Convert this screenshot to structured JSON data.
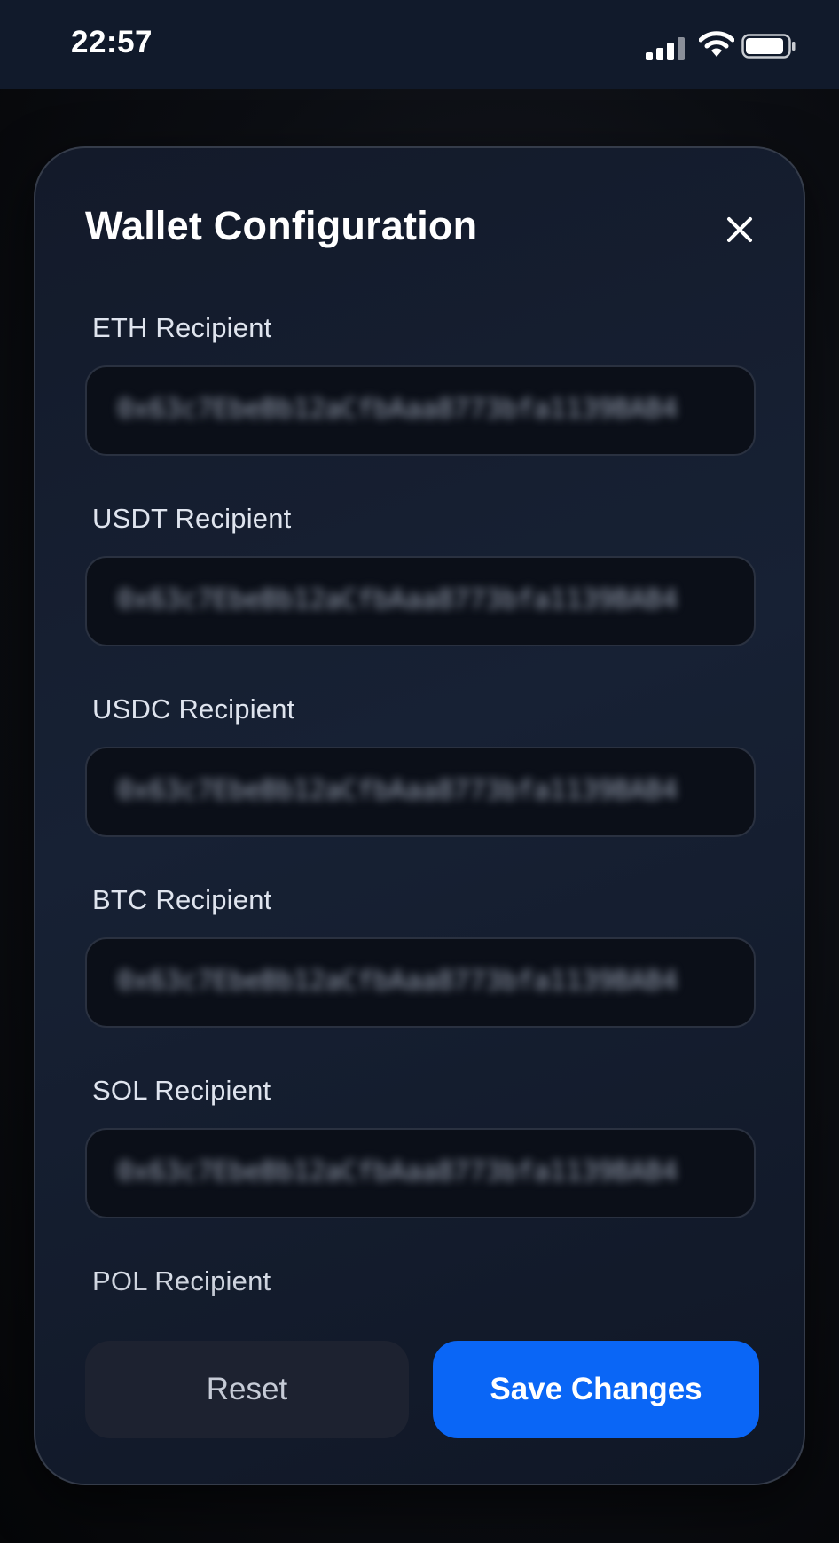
{
  "status_bar": {
    "time": "22:57",
    "icons": [
      "signal-icon",
      "wifi-icon",
      "battery-icon"
    ]
  },
  "modal": {
    "title": "Wallet Configuration",
    "close_icon": "close-icon",
    "fields": [
      {
        "label": "ETH Recipient",
        "value": "0x63c7EbeBb12aCfbAaa8773bfa1139BAB4"
      },
      {
        "label": "USDT Recipient",
        "value": "0x63c7EbeBb12aCfbAaa8773bfa1139BAB4"
      },
      {
        "label": "USDC Recipient",
        "value": "0x63c7EbeBb12aCfbAaa8773bfa1139BAB4"
      },
      {
        "label": "BTC Recipient",
        "value": "0x63c7EbeBb12aCfbAaa8773bfa1139BAB4"
      },
      {
        "label": "SOL Recipient",
        "value": "0x63c7EbeBb12aCfbAaa8773bfa1139BAB4"
      },
      {
        "label": "POL Recipient",
        "value": ""
      }
    ],
    "reset_label": "Reset",
    "save_label": "Save Changes"
  },
  "colors": {
    "accent": "#0a66f6",
    "modal_background": "#151d2e",
    "status_bar_background": "#111a2b"
  }
}
